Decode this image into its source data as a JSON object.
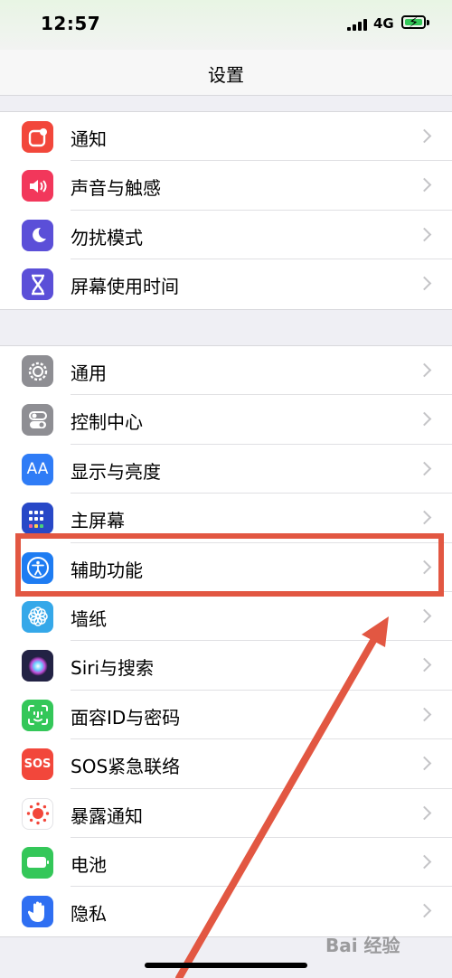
{
  "status_bar": {
    "time": "12:57",
    "network": "4G"
  },
  "nav": {
    "title": "设置"
  },
  "groups": [
    {
      "items": [
        {
          "label": "通知",
          "icon": "notification-icon",
          "color": "#f2473b"
        },
        {
          "label": "声音与触感",
          "icon": "speaker-icon",
          "color": "#f2375b"
        },
        {
          "label": "勿扰模式",
          "icon": "moon-icon",
          "color": "#5b4fd8"
        },
        {
          "label": "屏幕使用时间",
          "icon": "hourglass-icon",
          "color": "#5b4fd8"
        }
      ]
    },
    {
      "items": [
        {
          "label": "通用",
          "icon": "gear-icon",
          "color": "#8e8e93"
        },
        {
          "label": "控制中心",
          "icon": "toggles-icon",
          "color": "#8e8e93"
        },
        {
          "label": "显示与亮度",
          "icon": "text-size-icon",
          "color": "#2f7cf6"
        },
        {
          "label": "主屏幕",
          "icon": "home-grid-icon",
          "color": "#2848c7"
        },
        {
          "label": "辅助功能",
          "icon": "accessibility-icon",
          "color": "#1e7cf2"
        },
        {
          "label": "墙纸",
          "icon": "flower-icon",
          "color": "#35a8e9"
        },
        {
          "label": "Siri与搜索",
          "icon": "siri-icon",
          "color": "#222244"
        },
        {
          "label": "面容ID与密码",
          "icon": "face-id-icon",
          "color": "#34c759"
        },
        {
          "label": "SOS紧急联络",
          "icon": "sos-icon",
          "color": "#f2473b"
        },
        {
          "label": "暴露通知",
          "icon": "exposure-icon",
          "color": "#ffffff"
        },
        {
          "label": "电池",
          "icon": "battery-icon",
          "color": "#34c759"
        },
        {
          "label": "隐私",
          "icon": "hand-icon",
          "color": "#2f6ff2"
        }
      ]
    }
  ],
  "highlight_color": "#e25742",
  "watermark": "Bai 经验"
}
